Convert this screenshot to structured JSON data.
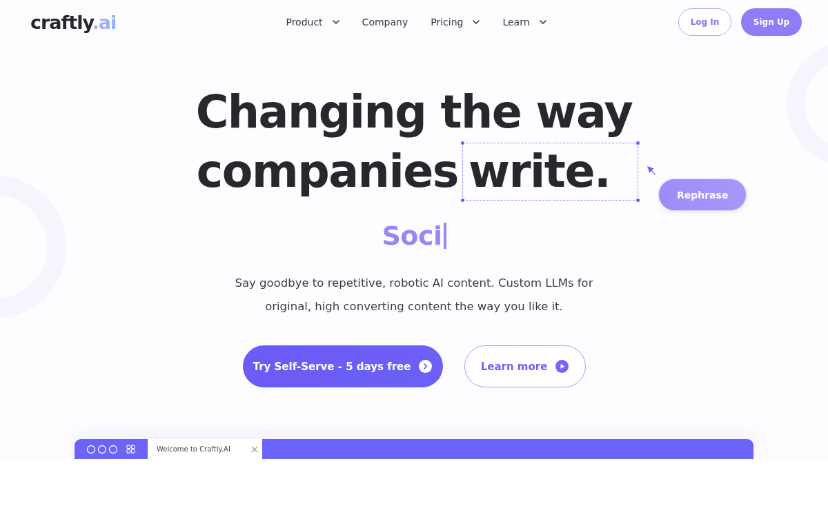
{
  "header": {
    "logo": {
      "name": "craftly",
      "suffix": ".ai"
    },
    "nav": [
      {
        "label": "Product",
        "dropdown": true
      },
      {
        "label": "Company",
        "dropdown": false
      },
      {
        "label": "Pricing",
        "dropdown": true
      },
      {
        "label": "Learn",
        "dropdown": true
      }
    ],
    "buttons": [
      {
        "label": "Log In",
        "kind": "outline"
      },
      {
        "label": "Sign Up",
        "kind": "filled"
      }
    ]
  },
  "hero": {
    "headline": {
      "line_1": "Changing the way",
      "line_2": "companies",
      "selected_word": "write."
    },
    "rephrase_button": "Rephrase",
    "typing_text": "Soci",
    "description": "Say goodbye to repetitive, robotic AI content. Custom LLMs for original, high converting content the way you like it.",
    "cta_buttons": [
      {
        "label": "Try Self-Serve - 5 days free",
        "kind": "primary"
      },
      {
        "label": "Learn more",
        "kind": "secondary"
      }
    ]
  },
  "app_window": {
    "tab_title": "Welcome to Craftly.AI"
  }
}
